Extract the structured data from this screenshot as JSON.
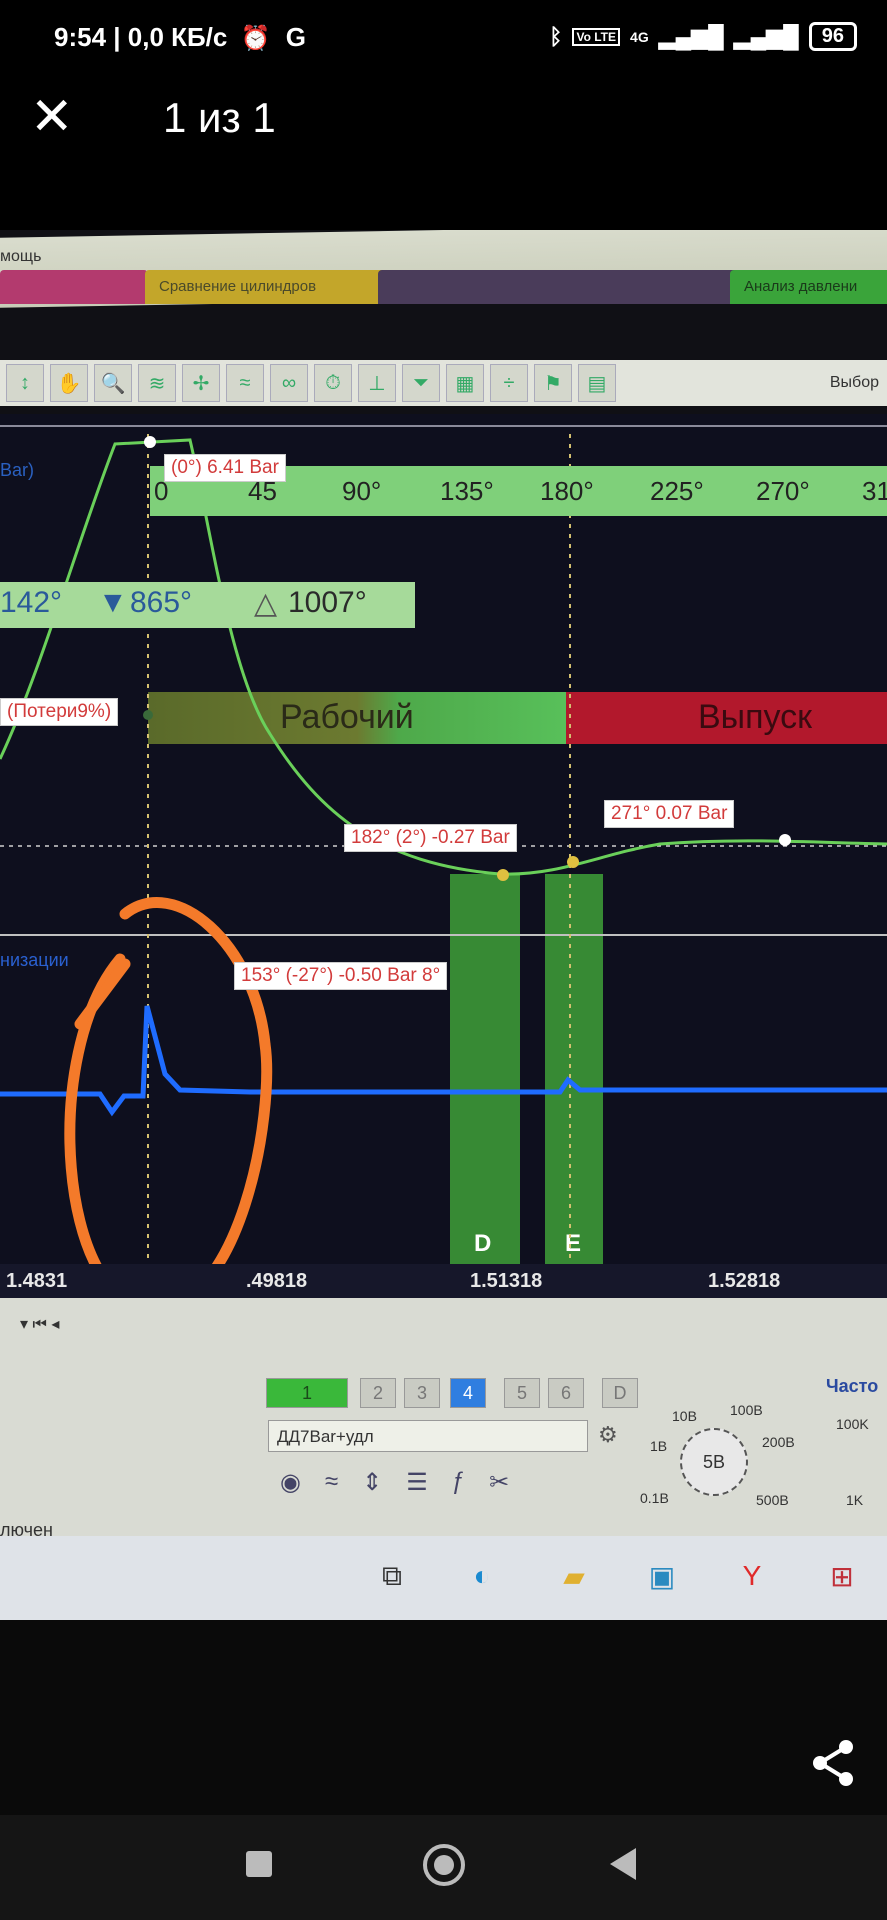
{
  "status_bar": {
    "time_info": "9:54 | 0,0 КБ/с",
    "g_label": "G",
    "net_label": "4G",
    "battery": "96"
  },
  "viewer": {
    "counter": "1 из 1"
  },
  "app": {
    "menu_fragment": "мощь",
    "tabs": [
      {
        "label": ""
      },
      {
        "label": "Сравнение цилиндров"
      },
      {
        "label": ""
      },
      {
        "label": "Анализ давлени"
      }
    ],
    "toolbar_right_label": "Выбор",
    "scope": {
      "left_label": "Bar)",
      "peak_label": "(0°) 6.41 Bar",
      "degree_ticks": [
        "0",
        "45",
        "90°",
        "135°",
        "180°",
        "225°",
        "270°",
        "31"
      ],
      "angle_left": "142°",
      "angle_mid": "865°",
      "angle_delta": "1007°",
      "loss_label": "(Потери9%)",
      "phase_work": "Рабочий",
      "phase_exhaust": "Выпуск",
      "marker_182": "182° (2°) -0.27 Bar",
      "marker_271": "271° 0.07 Bar",
      "marker_153": "153° (-27°) -0.50 Bar 8°",
      "lower_channel_label": "низации",
      "zone_d": "D",
      "zone_e": "E",
      "time_ticks": [
        "1.4831",
        ".49818",
        "1.51318",
        "1.52818"
      ]
    },
    "channels": [
      "1",
      "2",
      "3",
      "4",
      "5",
      "6",
      "D"
    ],
    "probe_combo": "ДД7Bar+удл",
    "scale_knob": {
      "center": "5В",
      "labels": [
        "10В",
        "100В",
        "1В",
        "200В",
        "0.1В",
        "500В"
      ]
    },
    "freq_knob": {
      "title": "Часто",
      "labels": [
        "100K",
        "1K"
      ]
    },
    "status_text": "лючен"
  },
  "colors": {
    "trace_green": "#6ad05a",
    "trace_blue": "#1f6cff",
    "annotation_orange": "#f47a2a"
  }
}
